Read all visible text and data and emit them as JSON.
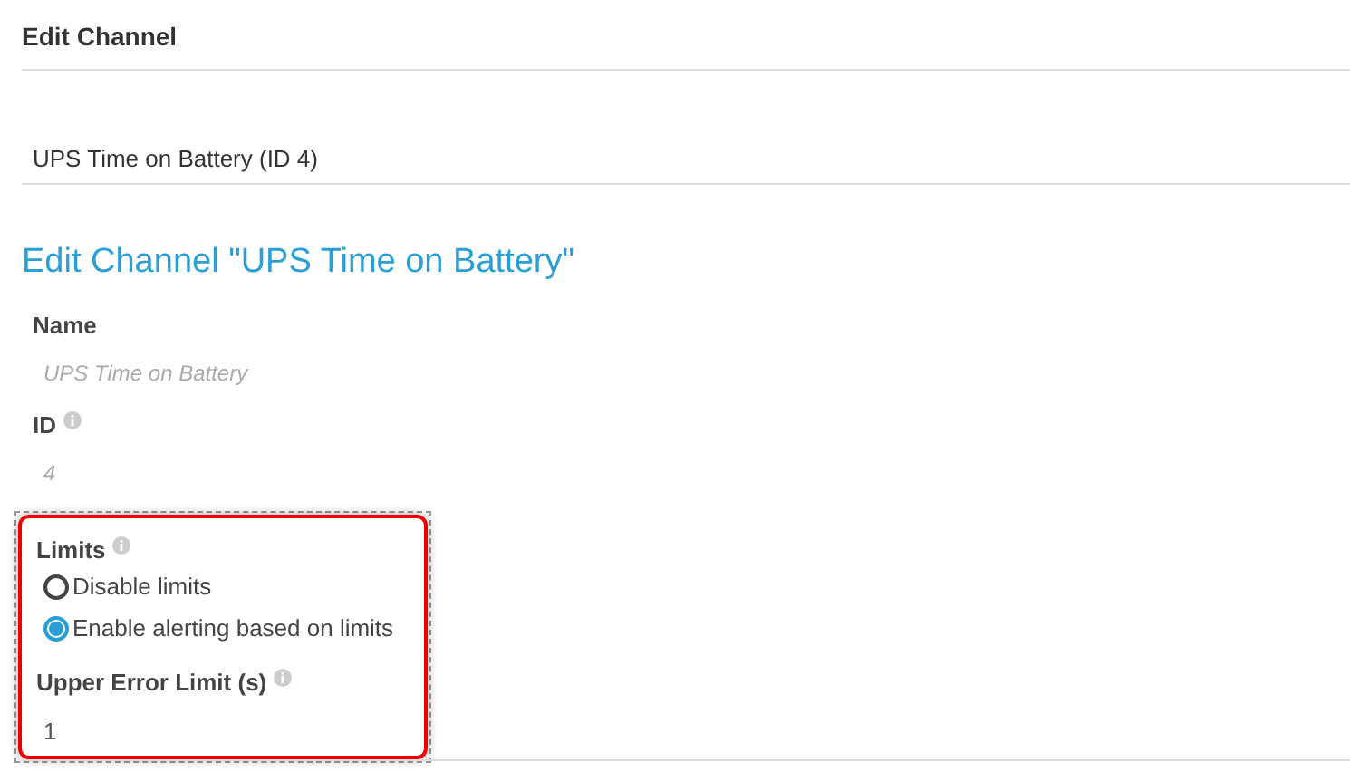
{
  "header": {
    "title": "Edit Channel"
  },
  "channel": {
    "label": "UPS Time on Battery (ID 4)"
  },
  "heading": "Edit Channel \"UPS Time on Battery\"",
  "fields": [
    {
      "label": "Name",
      "info": false,
      "value": "UPS Time on Battery"
    },
    {
      "label": "ID",
      "info": true,
      "value": "4"
    }
  ],
  "limits": {
    "label": "Limits",
    "info": true,
    "options": [
      {
        "label": "Disable limits",
        "selected": false
      },
      {
        "label": "Enable alerting based on limits",
        "selected": true
      }
    ],
    "upper_error": {
      "label": "Upper Error Limit (s)",
      "info": true,
      "value": "1"
    }
  }
}
